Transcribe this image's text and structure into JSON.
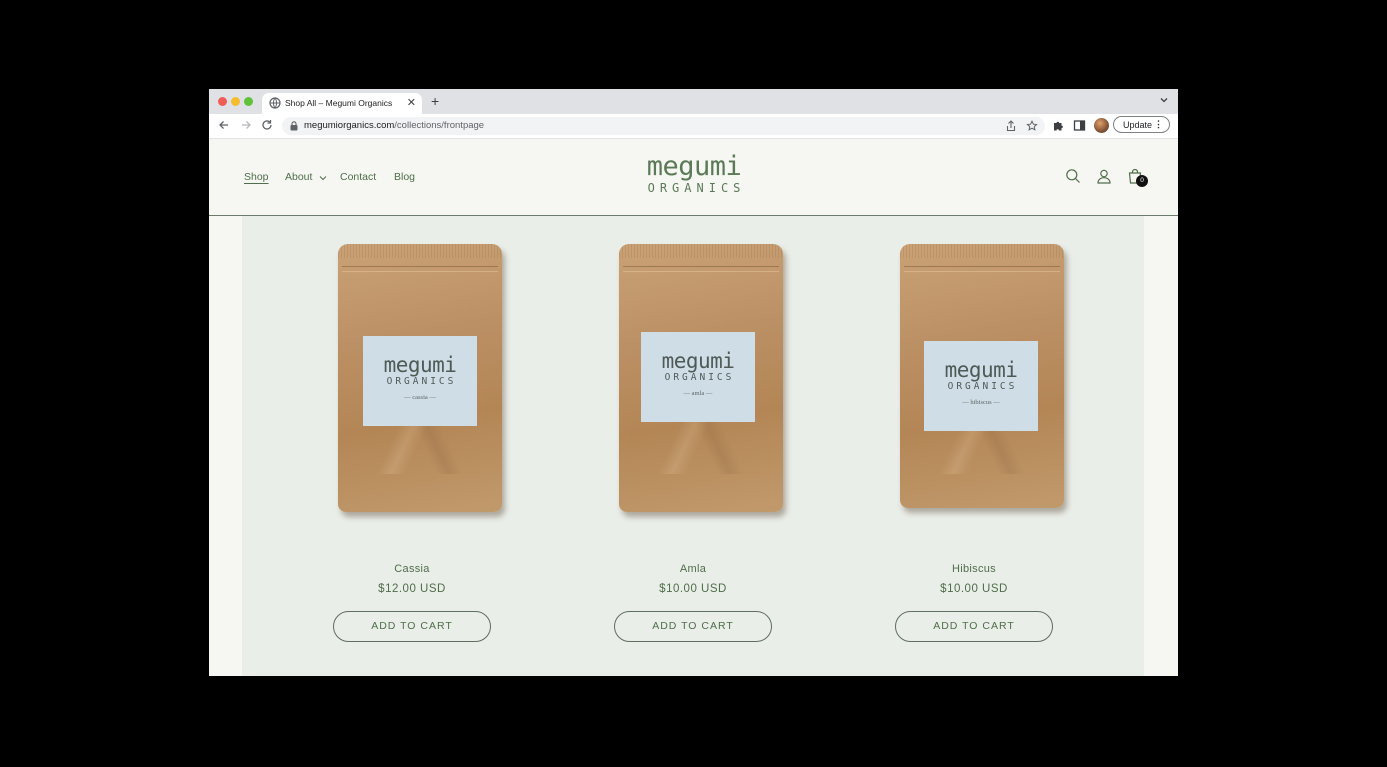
{
  "browser": {
    "tab_title": "Shop All – Megumi Organics",
    "new_tab_label": "+",
    "close_label": "✕",
    "url_host": "megumiorganics.com",
    "url_path": "/collections/frontpage",
    "update_label": "Update",
    "update_menu": "⋮"
  },
  "site": {
    "nav": {
      "shop": "Shop",
      "about": "About",
      "contact": "Contact",
      "blog": "Blog"
    },
    "logo": {
      "word": "megumi",
      "sub": "ORGANICS"
    },
    "cart_count": "0",
    "accent_color": "#4f6e4b"
  },
  "products": [
    {
      "name": "Cassia",
      "price": "$12.00 USD",
      "label_name": "— cassia —",
      "button": "ADD TO CART"
    },
    {
      "name": "Amla",
      "price": "$10.00 USD",
      "label_name": "— amla —",
      "button": "ADD TO CART"
    },
    {
      "name": "Hibiscus",
      "price": "$10.00 USD",
      "label_name": "— hibiscus —",
      "button": "ADD TO CART"
    }
  ],
  "pouch_label": {
    "word": "megumi",
    "sub": "ORGANICS"
  }
}
